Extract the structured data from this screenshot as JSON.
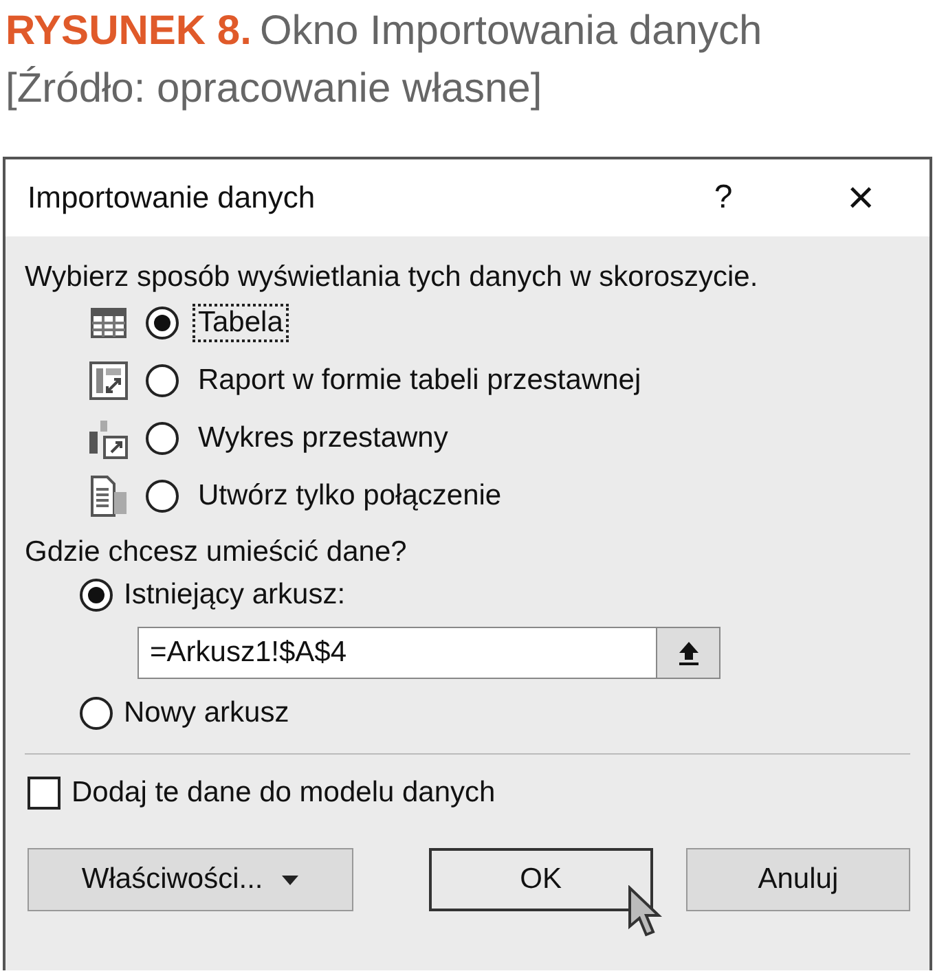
{
  "caption": {
    "label": "RYSUNEK 8.",
    "title": "Okno Importowania danych",
    "source": "[Źródło: opracowanie własne]"
  },
  "dialog": {
    "title": "Importowanie danych",
    "help": "?",
    "close": "×"
  },
  "view_prompt": "Wybierz sposób wyświetlania tych danych w skoroszycie.",
  "view_options": [
    {
      "kind": "table",
      "label": "Tabela",
      "selected": true,
      "focused": true
    },
    {
      "kind": "pivot-table",
      "label": "Raport w formie tabeli przestawnej",
      "selected": false,
      "focused": false
    },
    {
      "kind": "pivot-chart",
      "label": "Wykres przestawny",
      "selected": false,
      "focused": false
    },
    {
      "kind": "connection",
      "label": "Utwórz tylko połączenie",
      "selected": false,
      "focused": false
    }
  ],
  "place_prompt": "Gdzie chcesz umieścić dane?",
  "place_options": [
    {
      "label": "Istniejący arkusz:",
      "selected": true,
      "value": "=Arkusz1!$A$4"
    },
    {
      "label": "Nowy arkusz",
      "selected": false
    }
  ],
  "data_model": {
    "label": "Dodaj te dane do modelu danych",
    "checked": false
  },
  "buttons": [
    {
      "kind": "menu",
      "label": "Właściwości..."
    },
    {
      "kind": "default",
      "label": "OK",
      "hovered": true
    },
    {
      "kind": "plain",
      "label": "Anuluj"
    }
  ]
}
